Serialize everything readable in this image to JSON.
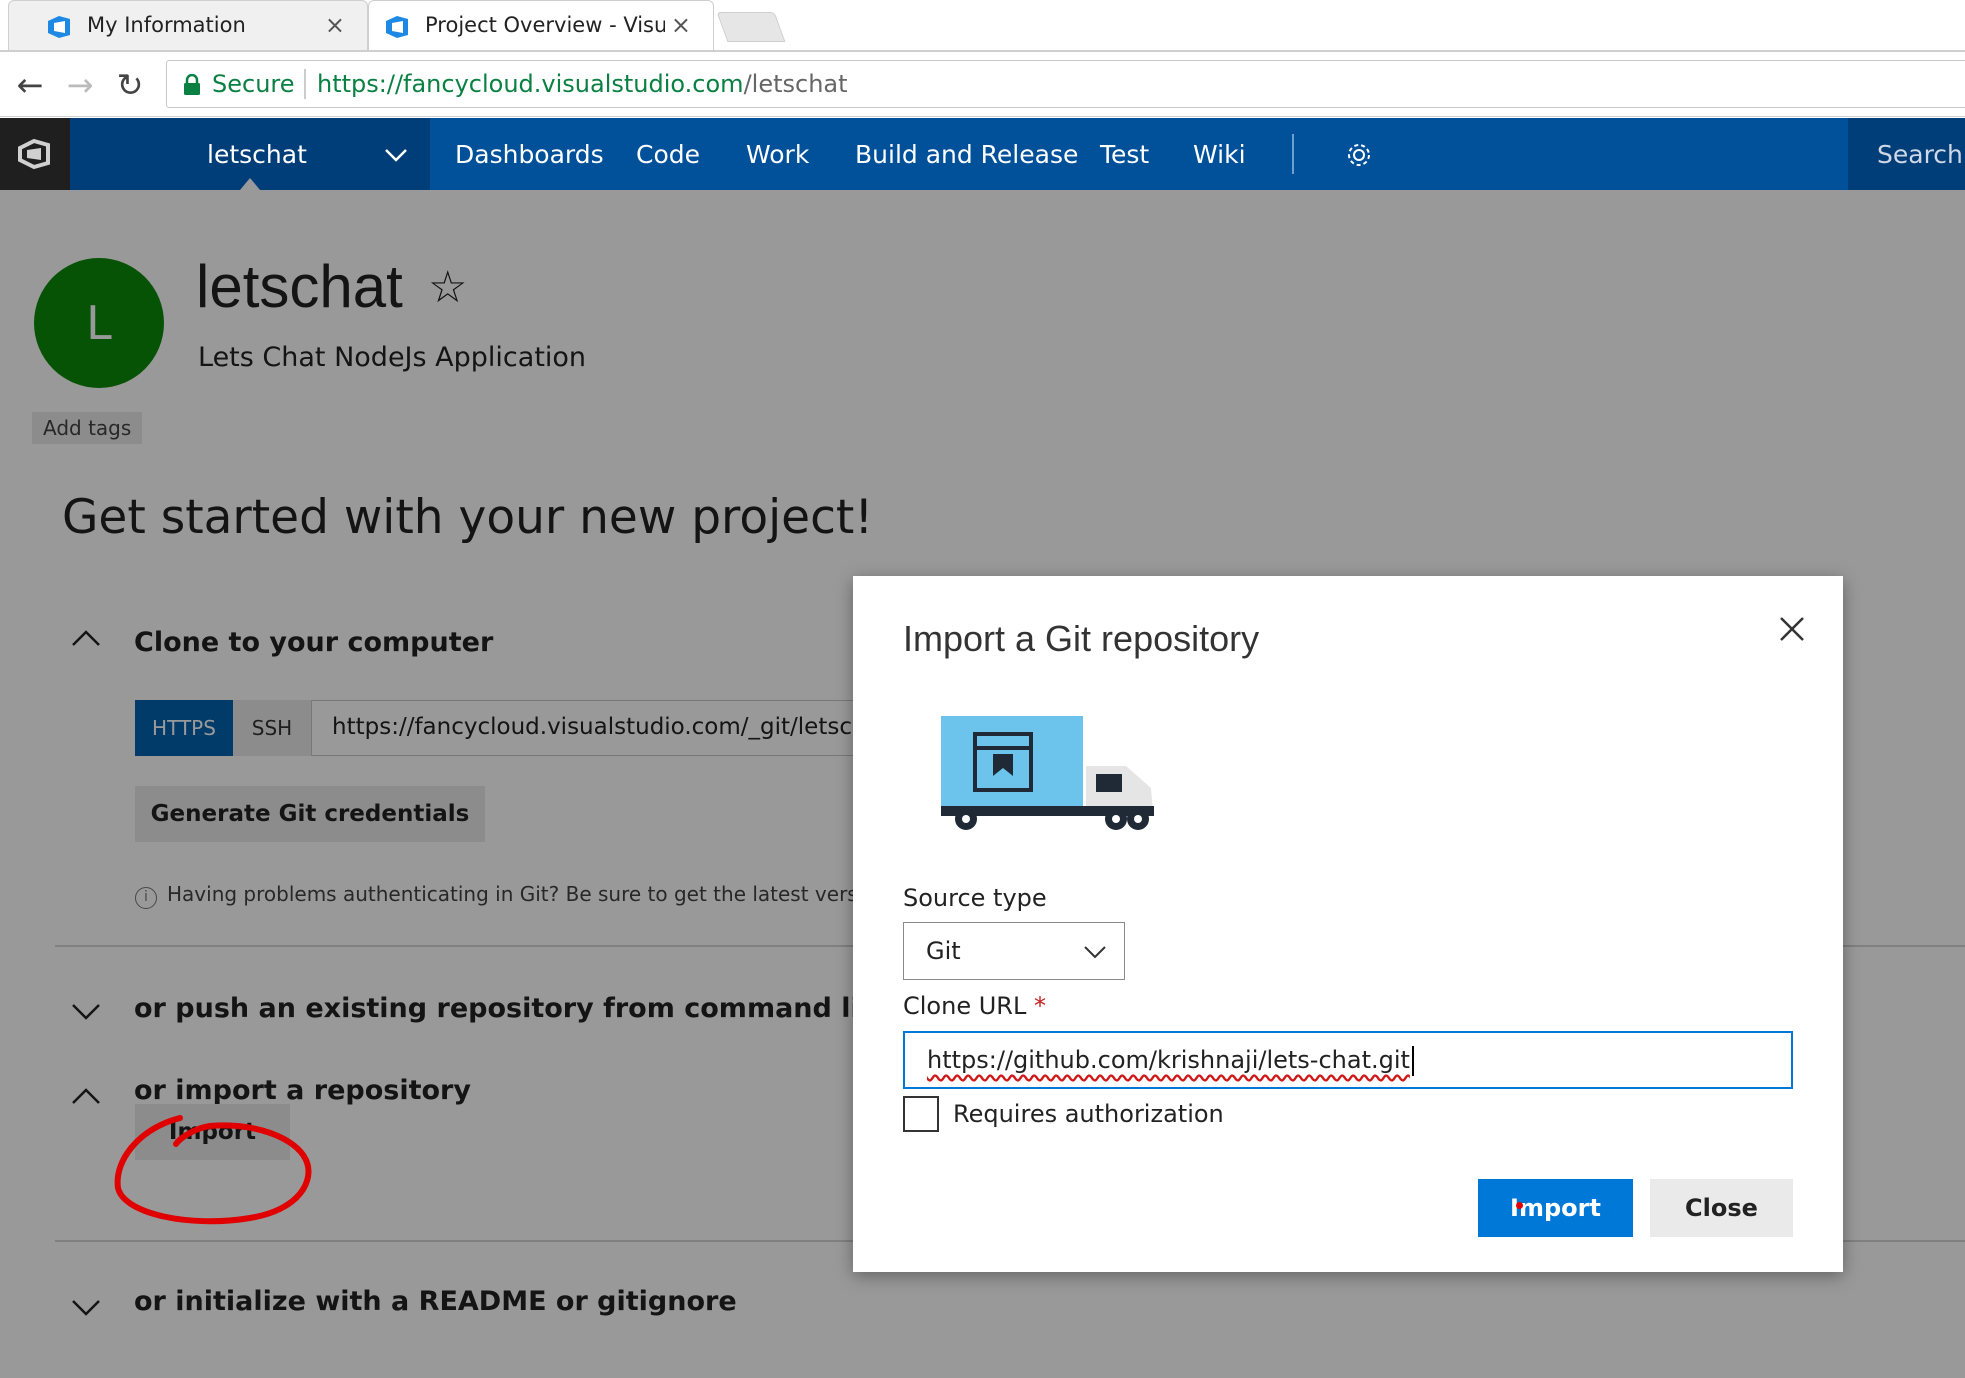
{
  "browser": {
    "tabs": [
      {
        "title": "My Information",
        "active": false
      },
      {
        "title": "Project Overview - Visual",
        "active": true
      }
    ],
    "security_label": "Secure",
    "url_scheme_host": "https://fancycloud.visualstudio.com",
    "url_path": "/letschat"
  },
  "header": {
    "project": "letschat",
    "nav": [
      "Dashboards",
      "Code",
      "Work",
      "Build and Release",
      "Test",
      "Wiki"
    ],
    "search_placeholder": "Search v",
    "colors": {
      "bar": "#00509a",
      "project_box": "#003e7a"
    }
  },
  "project": {
    "avatar_letter": "L",
    "avatar_color": "#0b8a0b",
    "title": "letschat",
    "description": "Lets Chat NodeJs Application",
    "add_tags": "Add tags"
  },
  "getting_started": {
    "heading": "Get started with your new project!",
    "clone_section": "Clone to your computer",
    "https_label": "HTTPS",
    "ssh_label": "SSH",
    "clone_url": "https://fancycloud.visualstudio.com/_git/letscha",
    "gen_credentials": "Generate Git credentials",
    "help_text": "Having problems authenticating in Git? Be sure to get the latest version",
    "push_section": "or push an existing repository from command line",
    "import_section": "or import a repository",
    "import_button": "Import",
    "readme_section": "or initialize with a README or gitignore"
  },
  "dialog": {
    "title": "Import a Git repository",
    "source_type_label": "Source type",
    "source_type_value": "Git",
    "clone_url_label": "Clone URL",
    "required_marker": "*",
    "clone_url_value": "https://github.com/krishnaji/lets-chat.git",
    "requires_auth_label": "Requires authorization",
    "import_button": "Import",
    "close_button": "Close",
    "accent_color": "#0078d7"
  },
  "annotation": {
    "color": "#e00000"
  }
}
